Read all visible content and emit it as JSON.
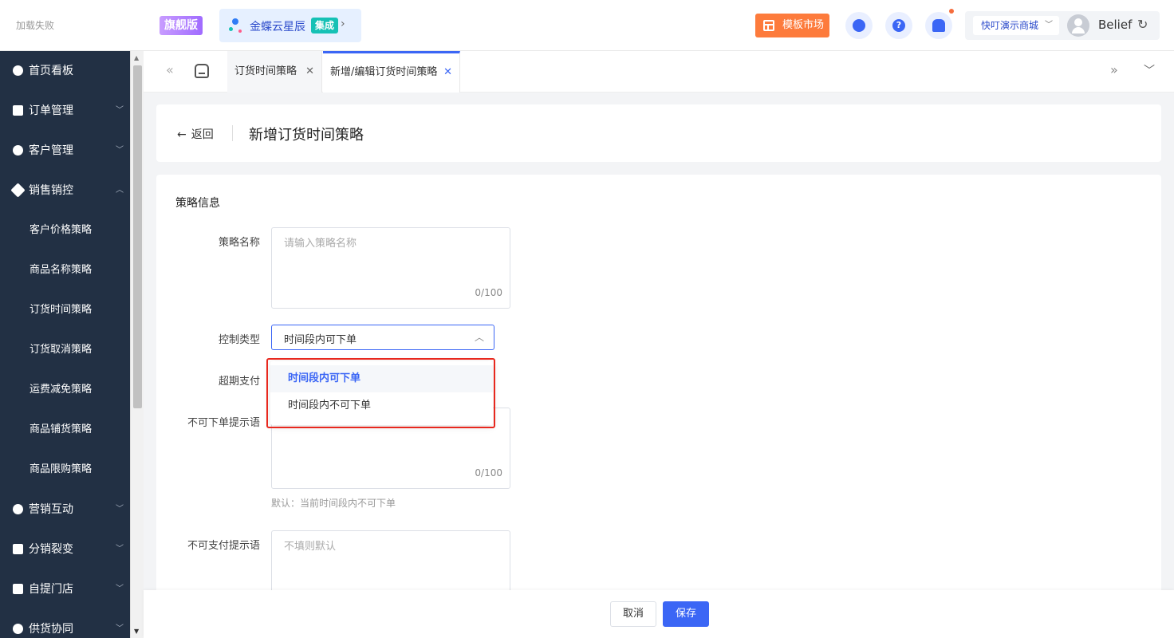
{
  "header": {
    "logo_text": "加载失败",
    "edition": "旗舰版",
    "product_name": "金蝶云星辰",
    "product_tag": "集成",
    "market_button": "模板市场",
    "help_glyph": "?",
    "store_select": "快叮演示商城",
    "username": "Belief",
    "icons": [
      "customer-service-icon",
      "help-icon",
      "bell-icon",
      "refresh-icon"
    ]
  },
  "sidebar": {
    "items": [
      {
        "label": "首页看板",
        "icon": "dashboard-icon"
      },
      {
        "label": "订单管理",
        "icon": "clipboard-icon"
      },
      {
        "label": "客户管理",
        "icon": "user-icon"
      },
      {
        "label": "销售销控",
        "icon": "tag-icon",
        "expanded": true
      },
      {
        "label": "营销互动",
        "icon": "target-icon"
      },
      {
        "label": "分销裂变",
        "icon": "network-icon"
      },
      {
        "label": "自提门店",
        "icon": "store-icon"
      },
      {
        "label": "供货协同",
        "icon": "supply-icon"
      }
    ],
    "sub_items": [
      "客户价格策略",
      "商品名称策略",
      "订货时间策略",
      "订货取消策略",
      "运费减免策略",
      "商品铺货策略",
      "商品限购策略"
    ]
  },
  "tabs": {
    "items": [
      {
        "label": "订货时间策略"
      },
      {
        "label": "新增/编辑订货时间策略",
        "active": true
      }
    ]
  },
  "page": {
    "back_label": "返回",
    "title": "新增订货时间策略",
    "section_title": "策略信息",
    "fields": {
      "name_label": "策略名称",
      "name_placeholder": "请输入策略名称",
      "name_count": "0/100",
      "control_type_label": "控制类型",
      "control_type_value": "时间段内可下单",
      "overdue_pay_label": "超期支付",
      "no_order_tip_label": "不可下单提示语",
      "no_order_tip_count": "0/100",
      "no_order_tip_hint": "默认：当前时间段内不可下单",
      "no_pay_tip_label": "不可支付提示语",
      "no_pay_tip_placeholder": "不填则默认"
    },
    "dropdown_options": [
      {
        "label": "时间段内可下单",
        "selected": true
      },
      {
        "label": "时间段内不可下单",
        "selected": false
      }
    ]
  },
  "footer": {
    "cancel_label": "取消",
    "save_label": "保存"
  },
  "colors": {
    "primary": "#3b66f5",
    "sidebar_bg": "#223044",
    "market_orange": "#fd7b3c",
    "highlight_red": "#e8281e"
  }
}
